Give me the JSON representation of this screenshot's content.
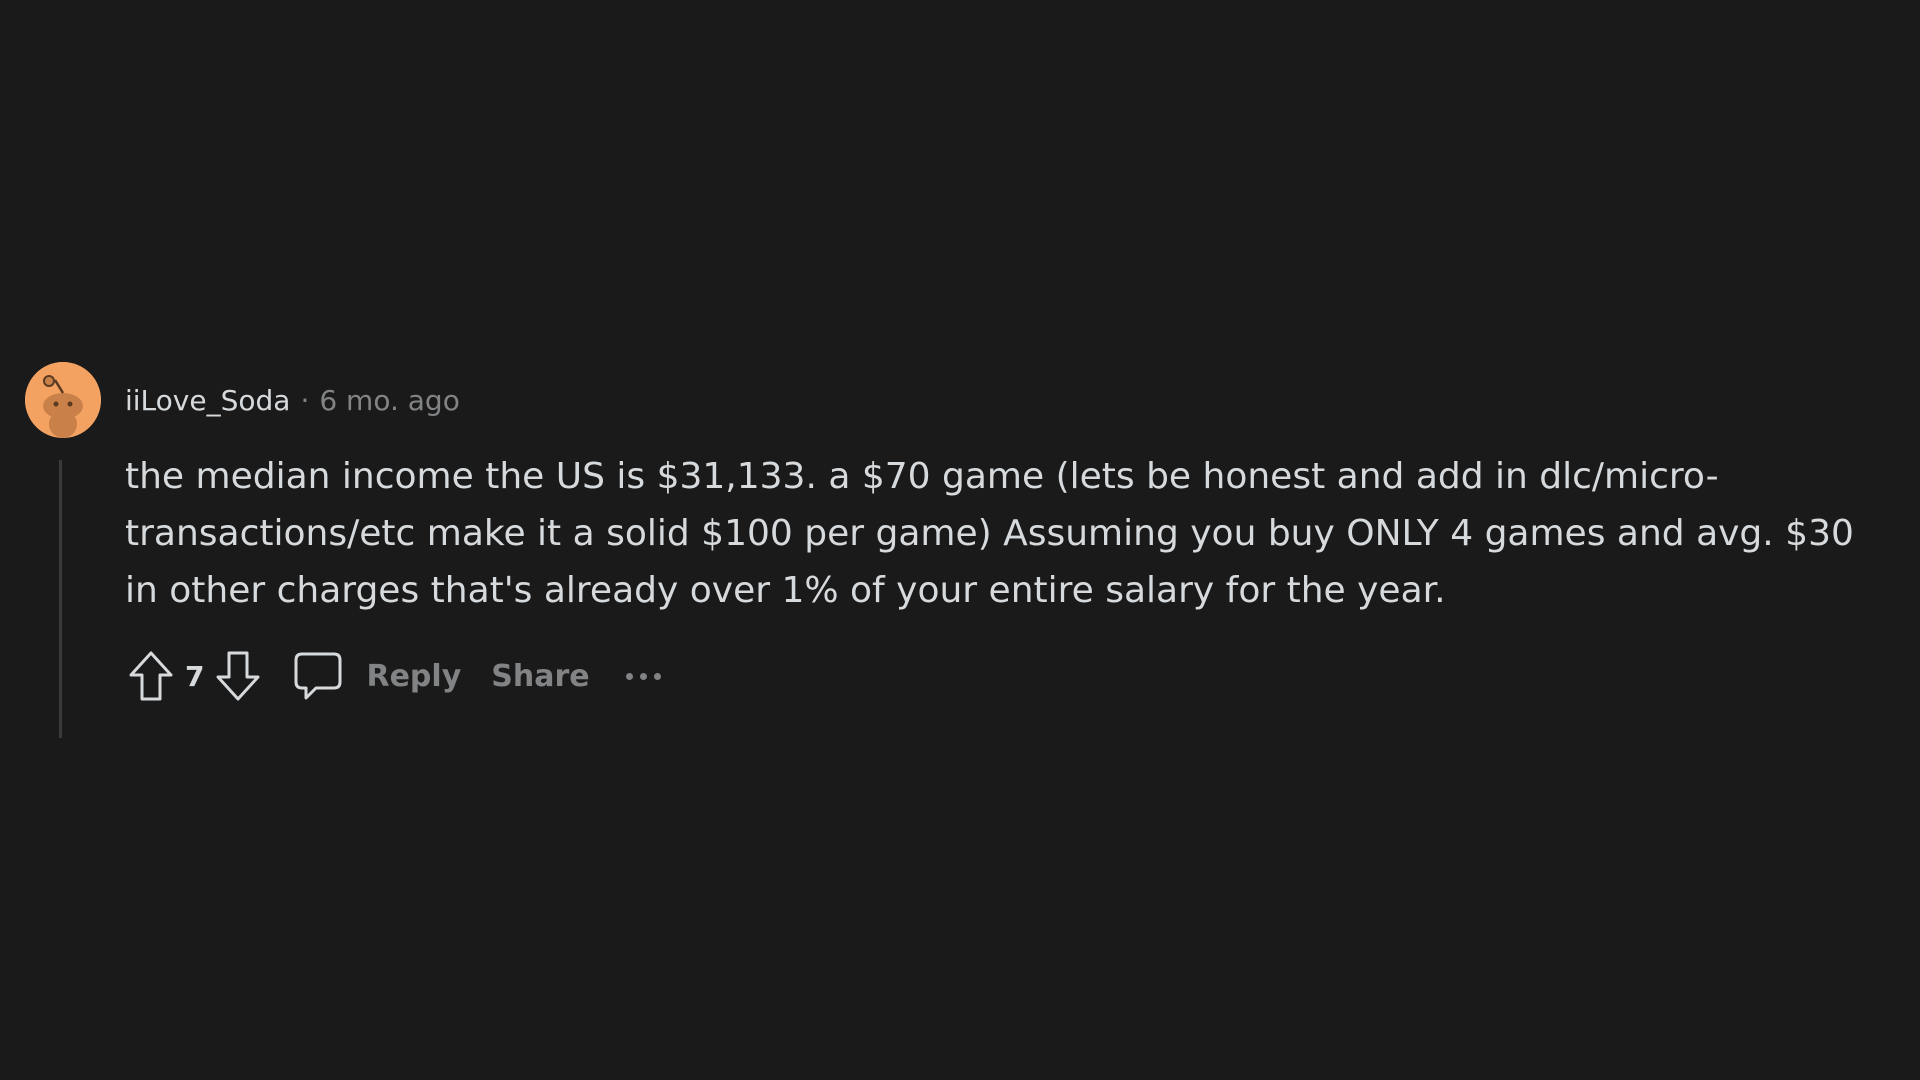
{
  "comment": {
    "author": "iiLove_Soda",
    "separator": "·",
    "timestamp": "6 mo. ago",
    "body": "the median income the US is $31,133. a $70 game (lets be honest and add in dlc/micro-transactions/etc make it a solid $100 per game) Assuming you buy ONLY 4 games and avg. $30 in other charges that's already over 1% of your entire salary for the year.",
    "vote_count": "7",
    "reply_label": "Reply",
    "share_label": "Share"
  },
  "colors": {
    "background": "#1a1a1b",
    "text": "#d7dadc",
    "muted": "#818384",
    "avatar": "#f4a261"
  }
}
